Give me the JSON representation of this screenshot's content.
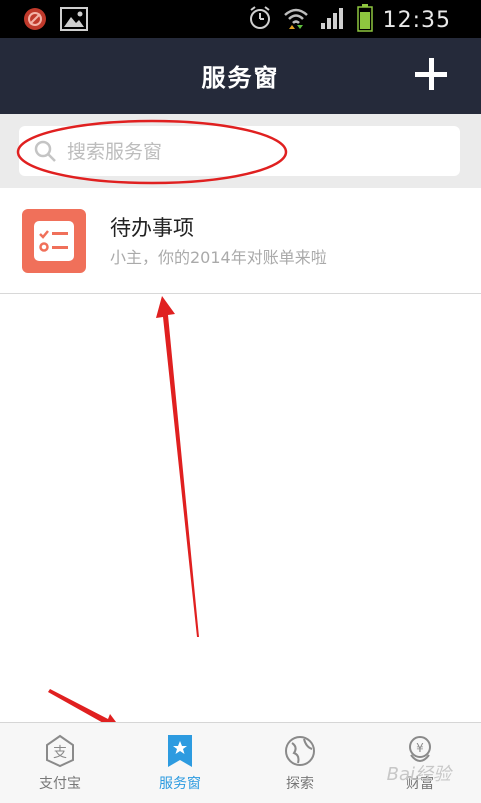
{
  "status_bar": {
    "time": "12:35"
  },
  "header": {
    "title": "服务窗"
  },
  "search": {
    "placeholder": "搜索服务窗"
  },
  "list": [
    {
      "title": "待办事项",
      "subtitle": "小主，你的2014年对账单来啦"
    }
  ],
  "tabs": [
    {
      "label": "支付宝",
      "icon": "alipay-icon",
      "active": false
    },
    {
      "label": "服务窗",
      "icon": "bookmark-star-icon",
      "active": true
    },
    {
      "label": "探索",
      "icon": "globe-icon",
      "active": false
    },
    {
      "label": "财富",
      "icon": "wealth-icon",
      "active": false
    }
  ],
  "colors": {
    "header_bg": "#252a3a",
    "accent": "#2d9be0",
    "item_icon": "#f0705a",
    "annotation": "#e02020"
  },
  "watermark": "Bai经验"
}
